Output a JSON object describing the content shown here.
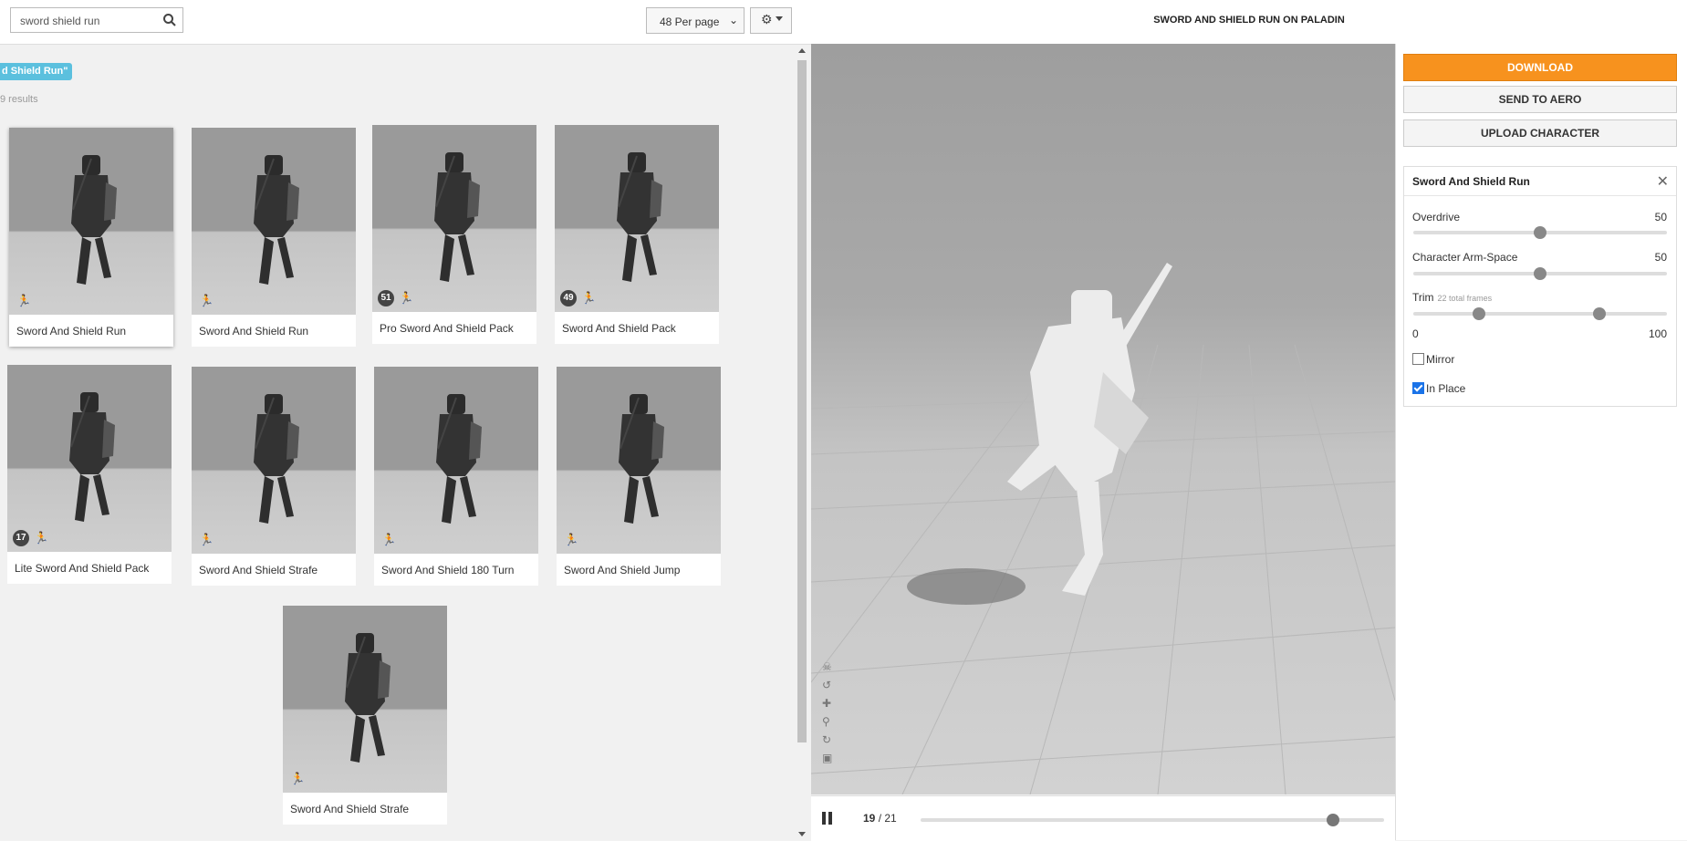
{
  "search": {
    "value": "sword shield run"
  },
  "per_page": "48 Per page",
  "filter_tag": "d Shield Run\"",
  "results_text": "9 results",
  "cards": [
    {
      "label": "Sword And Shield Run",
      "count": "",
      "pack": false,
      "selected": true
    },
    {
      "label": "Sword And Shield Run",
      "count": "",
      "pack": false,
      "selected": false
    },
    {
      "label": "Pro Sword And Shield Pack",
      "count": "51",
      "pack": true,
      "selected": false
    },
    {
      "label": "Sword And Shield Pack",
      "count": "49",
      "pack": true,
      "selected": false
    },
    {
      "label": "Lite Sword And Shield Pack",
      "count": "17",
      "pack": true,
      "selected": false
    },
    {
      "label": "Sword And Shield Strafe",
      "count": "",
      "pack": false,
      "selected": false
    },
    {
      "label": "Sword And Shield 180 Turn",
      "count": "",
      "pack": false,
      "selected": false
    },
    {
      "label": "Sword And Shield Jump",
      "count": "",
      "pack": false,
      "selected": false
    },
    {
      "label": "Sword And Shield Strafe",
      "count": "",
      "pack": false,
      "selected": false
    }
  ],
  "viewer": {
    "title": "SWORD AND SHIELD RUN ON PALADIN",
    "current_frame": "19",
    "total_frames": "/ 21",
    "playhead_fraction": 0.9
  },
  "actions": {
    "download": "DOWNLOAD",
    "send_to_aero": "SEND TO AERO",
    "upload_character": "UPLOAD CHARACTER"
  },
  "settings": {
    "title": "Sword And Shield Run",
    "overdrive_label": "Overdrive",
    "overdrive_value": "50",
    "armspace_label": "Character Arm-Space",
    "armspace_value": "50",
    "trim_label": "Trim",
    "trim_sub": "22 total frames",
    "trim_min": "0",
    "trim_max": "100",
    "mirror_label": "Mirror",
    "mirror_checked": false,
    "inplace_label": "In Place",
    "inplace_checked": true
  },
  "colors": {
    "accent": "#f7921e",
    "tag": "#5bc0de"
  }
}
